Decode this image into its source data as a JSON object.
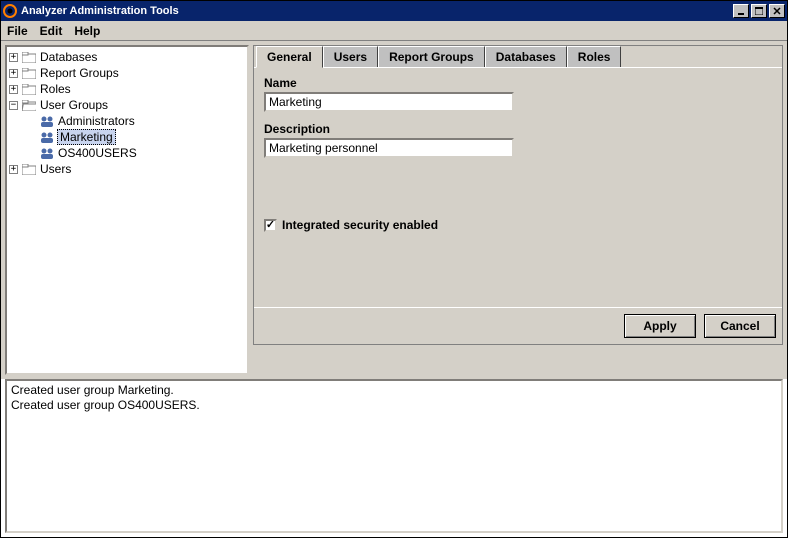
{
  "window": {
    "title": "Analyzer Administration Tools"
  },
  "menu": {
    "file": "File",
    "edit": "Edit",
    "help": "Help"
  },
  "tree": {
    "databases": "Databases",
    "report_groups": "Report Groups",
    "roles": "Roles",
    "user_groups": "User Groups",
    "user_groups_children": {
      "0": "Administrators",
      "1": "Marketing",
      "2": "OS400USERS"
    },
    "users": "Users"
  },
  "tabs": {
    "general": "General",
    "users": "Users",
    "report_groups": "Report Groups",
    "databases": "Databases",
    "roles": "Roles"
  },
  "form": {
    "name_label": "Name",
    "name_value": "Marketing",
    "desc_label": "Description",
    "desc_value": "Marketing personnel",
    "integrated_security_label": "Integrated security enabled"
  },
  "buttons": {
    "apply": "Apply",
    "cancel": "Cancel"
  },
  "log": {
    "0": "Created user group Marketing.",
    "1": "Created user group OS400USERS."
  }
}
